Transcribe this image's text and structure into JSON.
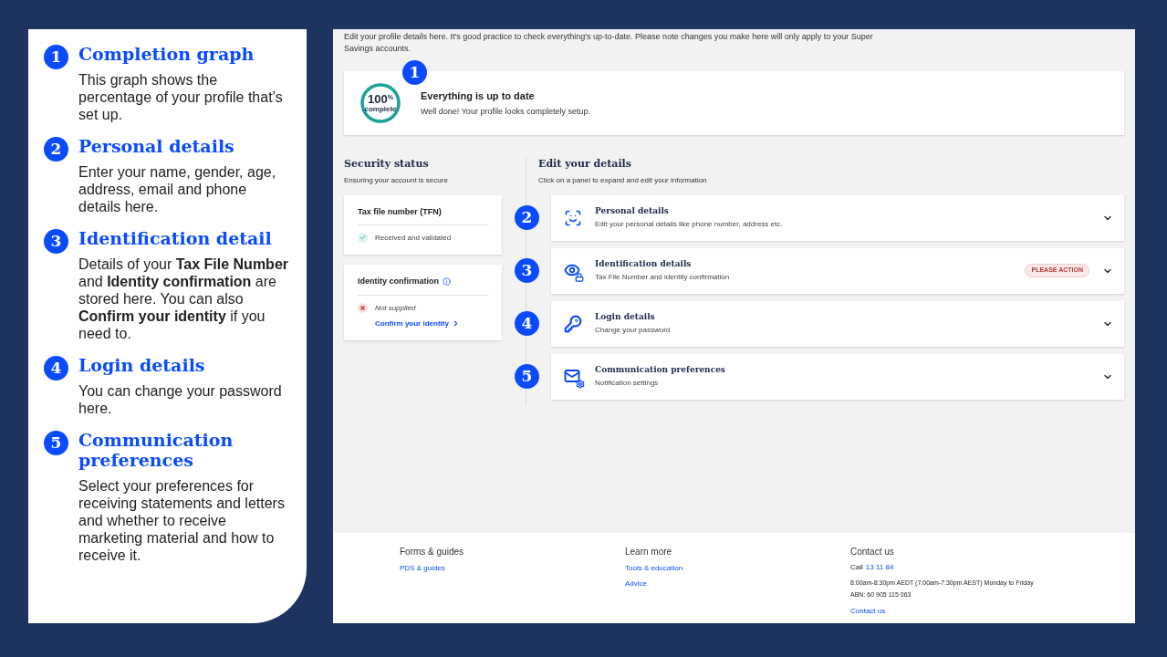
{
  "guide": {
    "items": [
      {
        "number": "1",
        "title": "Completion graph",
        "body": "This graph shows the percentage of your profile that’s set up."
      },
      {
        "number": "2",
        "title": "Personal details",
        "body": "Enter your name, gender, age, address, email and phone details here."
      },
      {
        "number": "3",
        "title": "Identification detail",
        "body": "Details of your **Tax File Number** and **Identity confirmation** are stored here. You can also **Confirm your identity** if you need to."
      },
      {
        "number": "4",
        "title": "Login details",
        "body": "You can change your password here."
      },
      {
        "number": "5",
        "title": "Communication preferences",
        "body": "Select your preferences for receiving statements and letters and whether to receive marketing material and how to receive it."
      }
    ]
  },
  "screen": {
    "intro": "Edit your profile details here. It's good practice to check everything's up-to-date. Please note changes you make here will only apply to your Super Savings accounts.",
    "completion": {
      "badge": "1",
      "percent": "100",
      "percent_sign": "%",
      "label": "complete",
      "level": 1,
      "title": "Everything is up to date",
      "text": "Well done! Your profile looks completely setup."
    },
    "security": {
      "title": "Security status",
      "subtitle": "Ensuring your account is secure",
      "cards": [
        {
          "title": "Tax file number (TFN)",
          "info": false,
          "validated": true,
          "status_text": "Received and validated"
        },
        {
          "title": "Identity confirmation",
          "info": true,
          "validated": false,
          "status_text": "Not supplied",
          "link": "Confirm your identity"
        }
      ]
    },
    "edit": {
      "title": "Edit your details",
      "subtitle": "Click on a panel to expand and edit your information",
      "panels": [
        {
          "badge": "2",
          "kind": "personal",
          "title": "Personal details",
          "subtitle": "Edit your personal details like phone number, address etc.",
          "expanded": false
        },
        {
          "badge": "3",
          "kind": "identification",
          "title": "Identification details",
          "subtitle": "Tax File Number and identity confirmation",
          "tag": "PLEASE ACTION",
          "expanded": false
        },
        {
          "badge": "4",
          "kind": "login",
          "title": "Login details",
          "subtitle": "Change your password",
          "expanded": false
        },
        {
          "badge": "5",
          "kind": "communication",
          "title": "Communication preferences",
          "subtitle": "Notification settings",
          "expanded": false
        }
      ]
    },
    "footer": {
      "columns": [
        {
          "heading": "Forms & guides",
          "links": [
            "PDS & guides"
          ]
        },
        {
          "heading": "Learn more",
          "links": [
            "Tools & education",
            "Advice"
          ]
        }
      ],
      "contact": {
        "heading": "Contact us",
        "call_label": "Call",
        "phone": "13 11 84",
        "hours": "8:00am-8:30pm AEDT (7:00am-7:30pm AEST) Monday to Friday",
        "abn": "ABN: 60 905 115 063",
        "link": "Contact us"
      }
    }
  }
}
